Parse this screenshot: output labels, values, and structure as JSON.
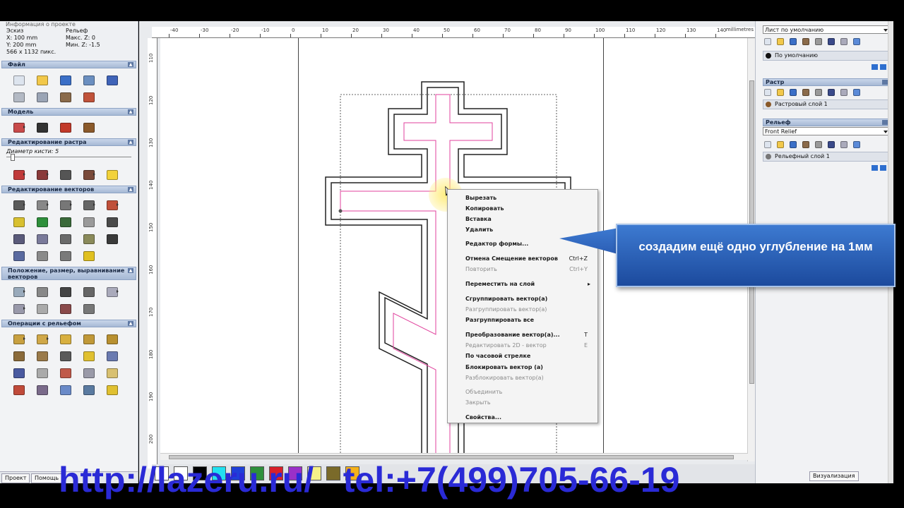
{
  "info": {
    "header": "Информация о проекте",
    "col1": [
      "Эскиз",
      "X: 100 mm",
      "Y: 200 mm",
      "566 x 1132 пикс."
    ],
    "col2": [
      "Рельеф",
      "Макс. Z: 0",
      "Мин. Z: -1.5"
    ]
  },
  "left_panel": {
    "sections": {
      "file": "Файл",
      "model": "Модель",
      "raster_edit": "Редактирование растра",
      "vector_edit": "Редактирование векторов",
      "position": "Положение, размер, выравнивание векторов",
      "relief_ops": "Операции с рельефом"
    },
    "brush_label": "Диаметр кисти: 5",
    "tabs": [
      "Проект",
      "Помощь"
    ]
  },
  "ruler": {
    "units": "millimetres",
    "top_labels": [
      "-40",
      "-30",
      "-20",
      "-10",
      "0",
      "10",
      "20",
      "30",
      "40",
      "50",
      "60",
      "70",
      "80",
      "90",
      "100",
      "110",
      "120",
      "130",
      "140"
    ],
    "left_labels": [
      "110",
      "120",
      "130",
      "140",
      "150",
      "160",
      "170",
      "180",
      "190",
      "200"
    ]
  },
  "context_menu": {
    "items": [
      {
        "label": "Вырезать",
        "enabled": true
      },
      {
        "label": "Копировать",
        "enabled": true
      },
      {
        "label": "Вставка",
        "enabled": true
      },
      {
        "label": "Удалить",
        "enabled": true
      },
      {
        "label": "Редактор формы...",
        "enabled": true
      },
      {
        "label": "Отмена Смещение векторов",
        "shortcut": "Ctrl+Z",
        "enabled": true
      },
      {
        "label": "Повторить",
        "shortcut": "Ctrl+Y",
        "enabled": false
      },
      {
        "label": "Переместить на слой",
        "submenu": true,
        "enabled": true
      },
      {
        "label": "Сгруппировать вектор(а)",
        "enabled": true
      },
      {
        "label": "Разгруппировать вектор(а)",
        "enabled": false
      },
      {
        "label": "Разгруппировать все",
        "enabled": true
      },
      {
        "label": "Преобразование вектор(а)...",
        "shortcut": "T",
        "enabled": true
      },
      {
        "label": "Редактировать 2D - вектор",
        "shortcut": "E",
        "enabled": false
      },
      {
        "label": "По часовой стрелке",
        "enabled": true
      },
      {
        "label": "Блокировать вектор (а)",
        "enabled": true
      },
      {
        "label": "Разблокировать вектор(а)",
        "enabled": false
      },
      {
        "label": "Объединить",
        "enabled": false
      },
      {
        "label": "Закрыть",
        "enabled": false
      },
      {
        "label": "Свойства...",
        "enabled": true
      }
    ]
  },
  "right_panel": {
    "sheet_select": "Лист по умолчанию",
    "default_layer": "По умолчанию",
    "raster_section": "Растр",
    "raster_layer": "Растровый слой 1",
    "relief_section": "Рельеф",
    "relief_select": "Front Relief",
    "relief_layer": "Рельефный слой 1",
    "bottom_tab": "Визуализация"
  },
  "callout": {
    "text": "создадим ещё одно углубление на 1мм"
  },
  "overlay": {
    "text": "http://lazeru.ru/   tel:+7(499)705-66-19"
  },
  "palette": {
    "colors": [
      "#ffffff",
      "#ffffff",
      "#000000",
      "#22e0f0",
      "#1f3fd8",
      "#2e8f3b",
      "#d8202a",
      "#9a30c8",
      "#f5f08a",
      "#7a6a2a",
      "#f6b21a"
    ]
  },
  "colors": {
    "vector_black": "#222222",
    "vector_magenta": "#e0409c",
    "callout_blue": "#2a62c0",
    "overlay_text": "#2a2ad6"
  }
}
